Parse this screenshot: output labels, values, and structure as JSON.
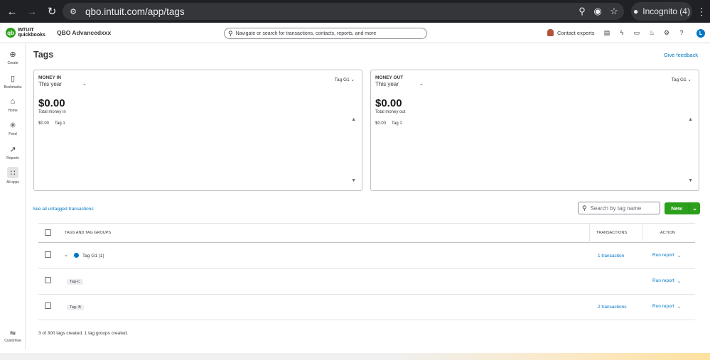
{
  "browser": {
    "url": "qbo.intuit.com/app/tags",
    "incognito_label": "Incognito (4)"
  },
  "header": {
    "logo_top": "INTUIT",
    "logo_bottom": "quickbooks",
    "company": "QBO Advancedxxx",
    "search_placeholder": "Navigate or search for transactions, contacts, reports, and more",
    "contact_label": "Contact experts",
    "user_initial": "L"
  },
  "sidebar": {
    "items": [
      {
        "label": "Create",
        "icon": "plus-circle-icon"
      },
      {
        "label": "Bookmarks",
        "icon": "bookmark-icon"
      },
      {
        "label": "Home",
        "icon": "home-icon"
      },
      {
        "label": "Feed",
        "icon": "feed-icon"
      },
      {
        "label": "Reports",
        "icon": "chart-icon"
      },
      {
        "label": "All apps",
        "icon": "grid-icon"
      }
    ],
    "customise_label": "Customise"
  },
  "page": {
    "title": "Tags",
    "feedback": "Give feedback"
  },
  "money_in": {
    "heading": "MONEY IN",
    "period": "This year",
    "tag_select": "Tag G1",
    "amount": "$0.00",
    "total_label": "Total money in",
    "row_amount": "$0.00",
    "row_tag": "Tag 1"
  },
  "money_out": {
    "heading": "MONEY OUT",
    "period": "This year",
    "tag_select": "Tag G1",
    "amount": "$0.00",
    "total_label": "Total money out",
    "row_amount": "$0.00",
    "row_tag": "Tag 1"
  },
  "toolbar": {
    "untagged_link": "See all untagged transactions",
    "search_placeholder": "Search by tag name",
    "new_label": "New"
  },
  "table": {
    "headers": {
      "name": "TAGS AND TAG GROUPS",
      "transactions": "TRANSACTIONS",
      "action": "ACTION"
    },
    "rows": [
      {
        "name": "Tag G1 (1)",
        "transactions": "1 transaction",
        "action": "Run report"
      },
      {
        "name": "Tag-C",
        "transactions": "",
        "action": "Run report"
      },
      {
        "name": "Tag- B",
        "transactions": "2 transactions",
        "action": "Run report"
      }
    ],
    "footer": "3 of 300 tags created. 1 tag groups created."
  },
  "colors": {
    "brand_green": "#2ca01c",
    "link_blue": "#0077c5"
  }
}
